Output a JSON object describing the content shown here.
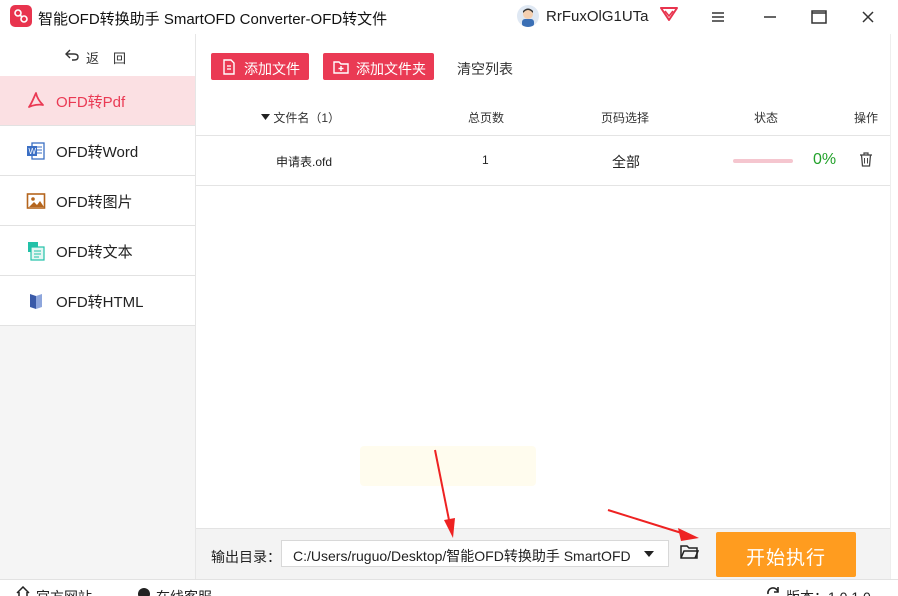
{
  "app": {
    "title": "智能OFD转换助手 SmartOFD Converter-OFD转文件",
    "username": "RrFuxOlG1UTa"
  },
  "sidebar": {
    "back_label": "返回",
    "items": [
      {
        "label": "OFD转Pdf",
        "icon": "pdf-icon",
        "active": true
      },
      {
        "label": "OFD转Word",
        "icon": "word-icon",
        "active": false
      },
      {
        "label": "OFD转图片",
        "icon": "image-icon",
        "active": false
      },
      {
        "label": "OFD转文本",
        "icon": "text-icon",
        "active": false
      },
      {
        "label": "OFD转HTML",
        "icon": "html-icon",
        "active": false
      }
    ]
  },
  "toolbar": {
    "add_file": "添加文件",
    "add_folder": "添加文件夹",
    "clear_list": "清空列表"
  },
  "table": {
    "columns": {
      "filename": "文件名（1）",
      "total_pages": "总页数",
      "page_select": "页码选择",
      "status": "状态",
      "action": "操作"
    },
    "rows": [
      {
        "filename": "申请表.ofd",
        "total_pages": "1",
        "page_select": "全部",
        "status": "0%",
        "progress": 0
      }
    ]
  },
  "output": {
    "label": "输出目录：",
    "path": "C:/Users/ruguo/Desktop/智能OFD转换助手 SmartOFD"
  },
  "start_button": "开始执行",
  "footer": {
    "website": "官方网站",
    "support": "在线客服",
    "version": "版本：1.0.1.0"
  },
  "colors": {
    "accent": "#ea3a54",
    "start": "#ff9c1f",
    "success": "#22a12a",
    "active_bg": "#fbe0e3"
  }
}
